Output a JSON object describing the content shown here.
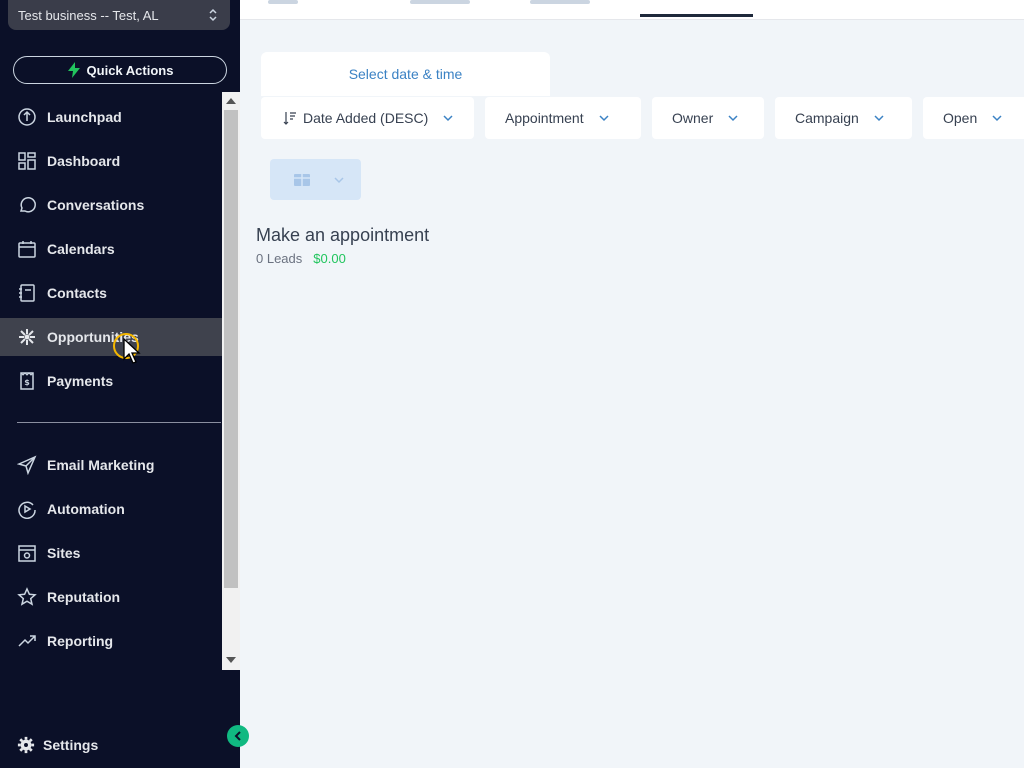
{
  "sidebar": {
    "business_selector": "Test business -- Test, AL",
    "quick_actions": "Quick Actions",
    "items": [
      {
        "label": "Launchpad",
        "icon": "launchpad-icon"
      },
      {
        "label": "Dashboard",
        "icon": "dashboard-icon"
      },
      {
        "label": "Conversations",
        "icon": "chat-icon"
      },
      {
        "label": "Calendars",
        "icon": "calendar-icon"
      },
      {
        "label": "Contacts",
        "icon": "contacts-icon"
      },
      {
        "label": "Opportunities",
        "icon": "opportunities-icon"
      },
      {
        "label": "Payments",
        "icon": "payments-icon"
      }
    ],
    "items2": [
      {
        "label": "Email Marketing",
        "icon": "send-icon"
      },
      {
        "label": "Automation",
        "icon": "automation-icon"
      },
      {
        "label": "Sites",
        "icon": "sites-icon"
      },
      {
        "label": "Reputation",
        "icon": "star-icon"
      },
      {
        "label": "Reporting",
        "icon": "trend-icon"
      }
    ],
    "settings": "Settings"
  },
  "main": {
    "date_selector": "Select date & time",
    "filters": {
      "sort": "Date Added (DESC)",
      "pipeline": "Appointment",
      "owner": "Owner",
      "campaign": "Campaign",
      "status": "Open"
    },
    "stage": {
      "title": "Make an appointment",
      "leads": "0 Leads",
      "value": "$0.00"
    }
  },
  "colors": {
    "sidebar_bg": "#0b1028",
    "active_item_bg": "#3f424d",
    "accent_link": "#3b82c4",
    "money_green": "#22c55e",
    "collapse_green": "#10b981"
  }
}
